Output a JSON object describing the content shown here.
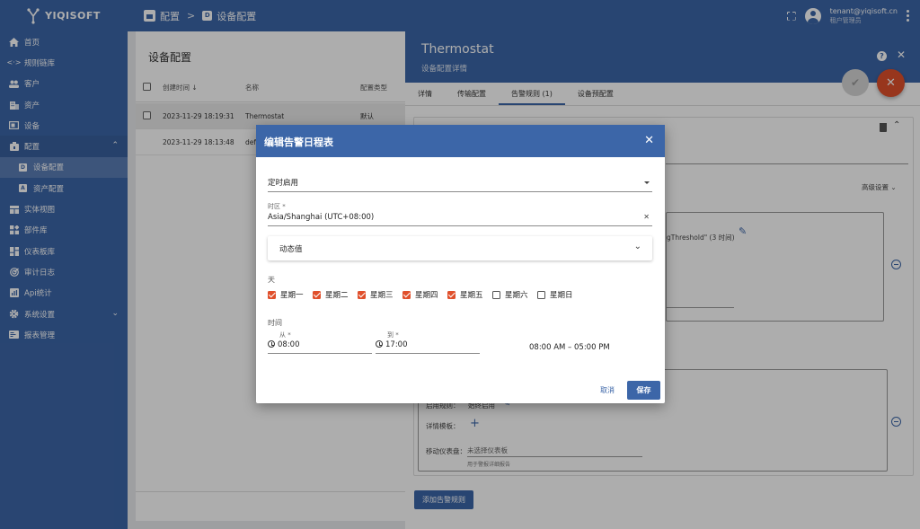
{
  "app": {
    "brand": "YIQISOFT",
    "breadcrumbs": [
      "配置",
      "设备配置"
    ],
    "user_email": "tenant@yiqisoft.cn",
    "user_role": "租户管理员"
  },
  "sidebar": {
    "items": [
      {
        "label": "首页",
        "icon": "home-icon"
      },
      {
        "label": "规则链库",
        "icon": "code-arrows-icon"
      },
      {
        "label": "客户",
        "icon": "people-icon"
      },
      {
        "label": "资产",
        "icon": "building-icon"
      },
      {
        "label": "设备",
        "icon": "device-icon"
      },
      {
        "label": "配置",
        "icon": "settings-box-icon"
      },
      {
        "label": "设备配置",
        "icon": "device-profile-icon"
      },
      {
        "label": "资产配置",
        "icon": "asset-profile-icon"
      },
      {
        "label": "实体视图",
        "icon": "view-icon"
      },
      {
        "label": "部件库",
        "icon": "widgets-icon"
      },
      {
        "label": "仪表板库",
        "icon": "dashboard-icon"
      },
      {
        "label": "审计日志",
        "icon": "track-icon"
      },
      {
        "label": "Api统计",
        "icon": "api-icon"
      },
      {
        "label": "系统设置",
        "icon": "gear-icon"
      },
      {
        "label": "报表管理",
        "icon": "report-icon"
      }
    ]
  },
  "main": {
    "title": "设备配置",
    "columns": [
      "创建时间",
      "名称",
      "配置类型"
    ],
    "rows": [
      {
        "time": "2023-11-29 18:19:31",
        "name": "Thermostat",
        "type": "默认"
      },
      {
        "time": "2023-11-29 18:13:48",
        "name": "def",
        "type": ""
      }
    ]
  },
  "detail": {
    "title": "Thermostat",
    "subtitle": "设备配置详情",
    "tabs": [
      "详情",
      "传输配置",
      "告警规则 (1)",
      "设备预配置"
    ],
    "advanced": "高级设置",
    "threshold_text": "gThreshold\" (3 时间)",
    "rule_label": "启用规则：",
    "rule_value": "始终启用",
    "detail_template": "详情模板：",
    "mobile_dashboard_label": "移动仪表盘：",
    "mobile_dashboard_placeholder": "未选择仪表板",
    "mobile_dashboard_hint": "用于警报详细报告",
    "add_alarm_rule": "添加告警规则"
  },
  "dialog": {
    "title": "编辑告警日程表",
    "schedule_type": "定时启用",
    "timezone_label": "时区 *",
    "timezone_value": "Asia/Shanghai (UTC+08:00)",
    "dynamic_value": "动态值",
    "days_label": "天",
    "days": [
      {
        "label": "星期一",
        "checked": true
      },
      {
        "label": "星期二",
        "checked": true
      },
      {
        "label": "星期三",
        "checked": true
      },
      {
        "label": "星期四",
        "checked": true
      },
      {
        "label": "星期五",
        "checked": true
      },
      {
        "label": "星期六",
        "checked": false
      },
      {
        "label": "星期日",
        "checked": false
      }
    ],
    "time_label": "时间",
    "from_label": "从 *",
    "from_value": "08:00",
    "to_label": "到 *",
    "to_value": "17:00",
    "range_text": "08:00 AM – 05:00 PM",
    "cancel": "取消",
    "save": "保存"
  },
  "colors": {
    "primary": "#3c66a8",
    "accent": "#e0502c"
  }
}
